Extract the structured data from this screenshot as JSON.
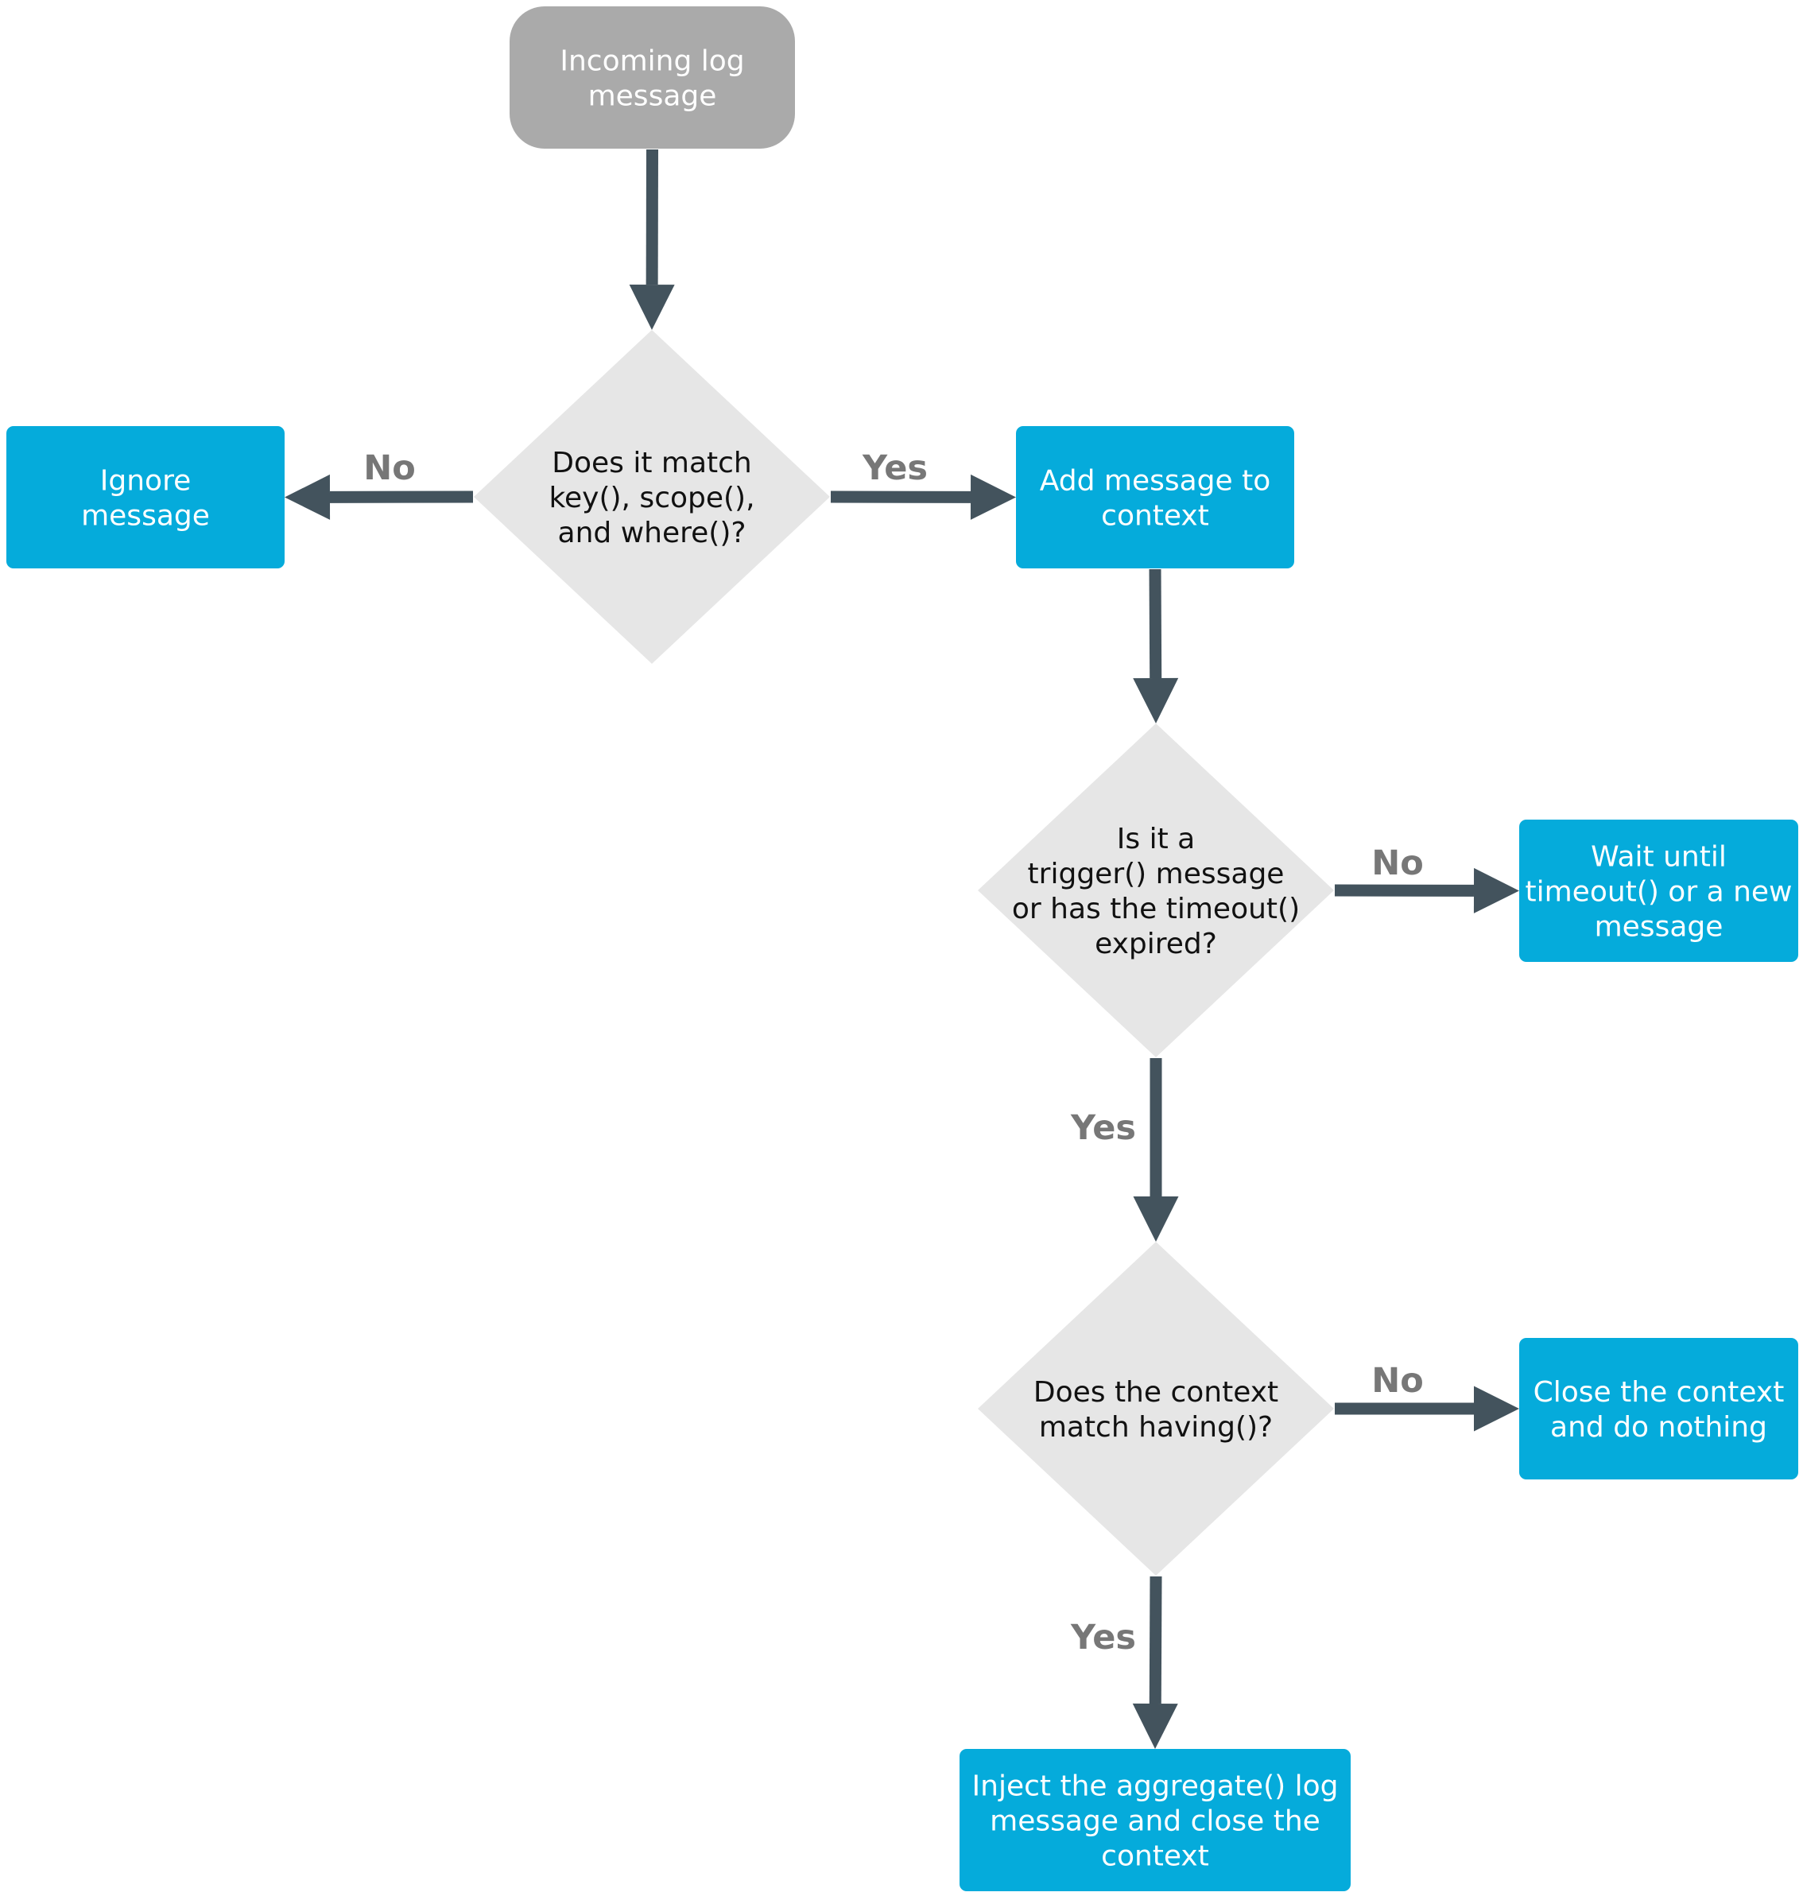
{
  "diagram": {
    "type": "flowchart",
    "colors": {
      "start": "#aaaaaa",
      "process": "#05abdb",
      "decision": "#e6e6e6",
      "arrow": "#43535d",
      "edge_label": "#777777",
      "text_light": "#ffffff",
      "text_dark": "#111111"
    },
    "nodes": [
      {
        "id": "incoming",
        "kind": "start",
        "lines": [
          "Incoming log",
          "message"
        ]
      },
      {
        "id": "match",
        "kind": "decision",
        "lines": [
          "Does it match",
          "key(), scope(),",
          "and where()?"
        ]
      },
      {
        "id": "ignore",
        "kind": "process",
        "lines": [
          "Ignore",
          "message"
        ]
      },
      {
        "id": "add",
        "kind": "process",
        "lines": [
          "Add message to",
          "context"
        ]
      },
      {
        "id": "trigger",
        "kind": "decision",
        "lines": [
          "Is it a",
          "trigger() message",
          "or has the timeout()",
          "expired?"
        ]
      },
      {
        "id": "wait",
        "kind": "process",
        "lines": [
          "Wait until",
          "timeout() or a new",
          "message"
        ]
      },
      {
        "id": "having",
        "kind": "decision",
        "lines": [
          "Does the context",
          "match having()?"
        ]
      },
      {
        "id": "close",
        "kind": "process",
        "lines": [
          "Close the context",
          "and do nothing"
        ]
      },
      {
        "id": "inject",
        "kind": "process",
        "lines": [
          "Inject the aggregate() log",
          "message and close the",
          "context"
        ]
      }
    ],
    "edges": [
      {
        "from": "incoming",
        "to": "match",
        "label": ""
      },
      {
        "from": "match",
        "to": "ignore",
        "label": "No"
      },
      {
        "from": "match",
        "to": "add",
        "label": "Yes"
      },
      {
        "from": "add",
        "to": "trigger",
        "label": ""
      },
      {
        "from": "trigger",
        "to": "wait",
        "label": "No"
      },
      {
        "from": "trigger",
        "to": "having",
        "label": "Yes"
      },
      {
        "from": "having",
        "to": "close",
        "label": "No"
      },
      {
        "from": "having",
        "to": "inject",
        "label": "Yes"
      }
    ]
  }
}
